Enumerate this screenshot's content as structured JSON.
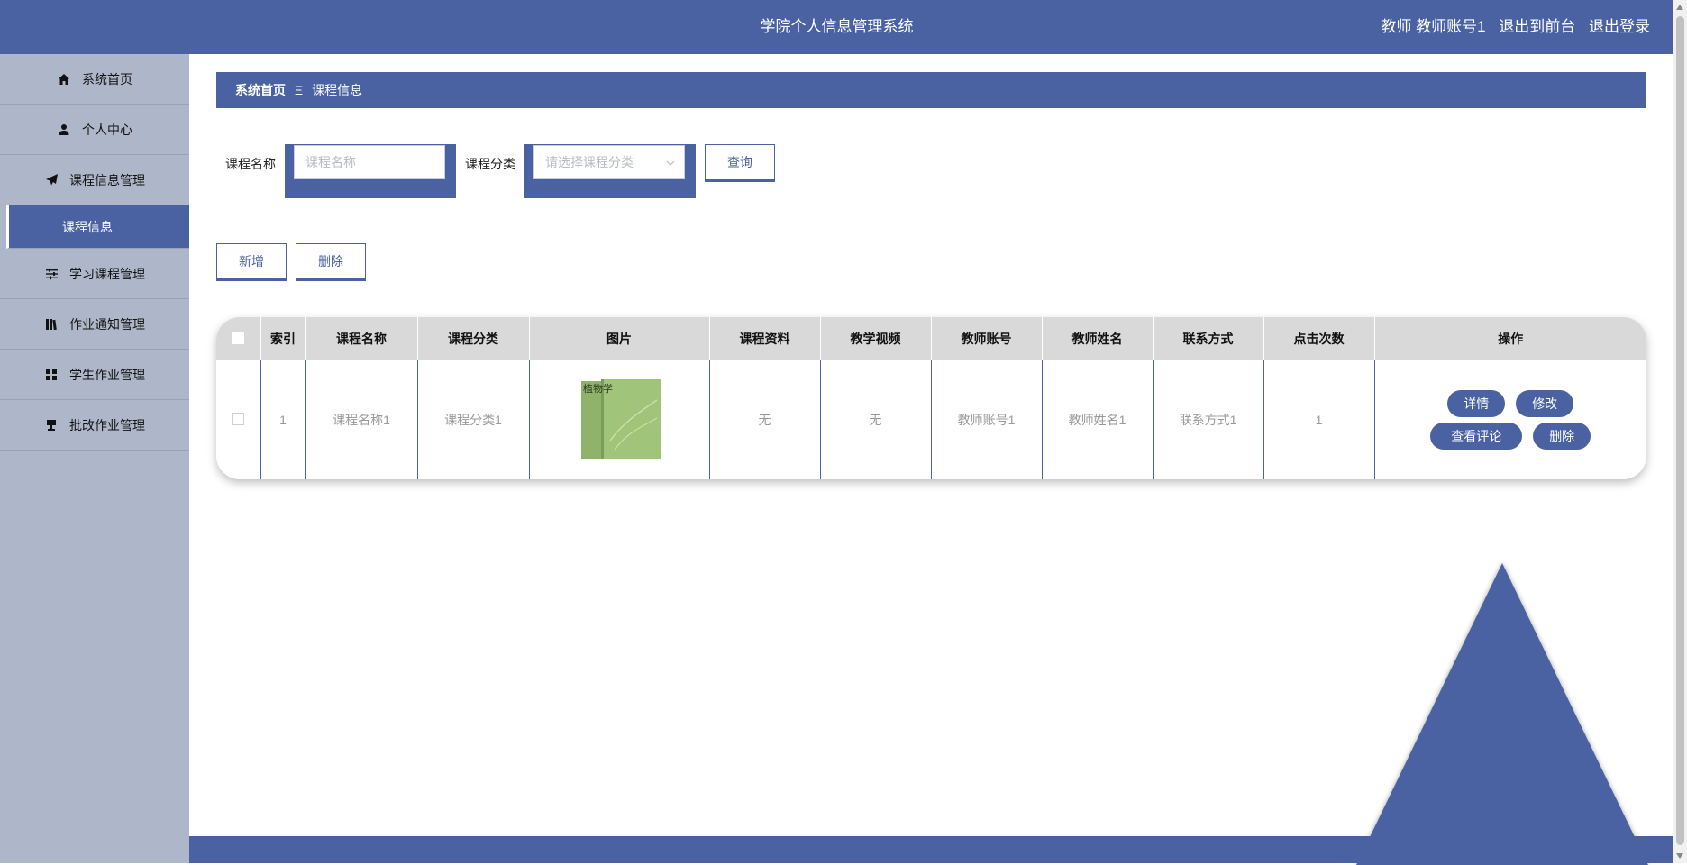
{
  "header": {
    "title": "学院个人信息管理系统",
    "user_role_label": "教师 教师账号1",
    "front_link": "退出到前台",
    "logout_link": "退出登录"
  },
  "sidebar": {
    "items": [
      {
        "label": "系统首页",
        "icon": "home-icon"
      },
      {
        "label": "个人中心",
        "icon": "user-icon"
      },
      {
        "label": "课程信息管理",
        "icon": "send-icon"
      },
      {
        "label": "课程信息",
        "icon": ""
      },
      {
        "label": "学习课程管理",
        "icon": "sliders-icon"
      },
      {
        "label": "作业通知管理",
        "icon": "book-icon"
      },
      {
        "label": "学生作业管理",
        "icon": "grid-icon"
      },
      {
        "label": "批改作业管理",
        "icon": "stamp-icon"
      }
    ]
  },
  "breadcrumb": {
    "home": "系统首页",
    "separator": "Ξ",
    "current": "课程信息"
  },
  "search": {
    "name_label": "课程名称",
    "name_placeholder": "课程名称",
    "category_label": "课程分类",
    "category_placeholder": "请选择课程分类",
    "query_button": "查询"
  },
  "actions": {
    "add_button": "新增",
    "delete_button": "删除"
  },
  "table": {
    "columns": [
      "索引",
      "课程名称",
      "课程分类",
      "图片",
      "课程资料",
      "教学视频",
      "教师账号",
      "教师姓名",
      "联系方式",
      "点击次数",
      "操作"
    ],
    "rows": [
      {
        "index": "1",
        "course_name": "课程名称1",
        "category": "课程分类1",
        "image_title": "植物学",
        "material": "无",
        "video": "无",
        "teacher_account": "教师账号1",
        "teacher_name": "教师姓名1",
        "contact": "联系方式1",
        "clicks": "1",
        "ops": {
          "detail": "详情",
          "edit": "修改",
          "comments": "查看评论",
          "delete": "删除"
        }
      }
    ]
  },
  "colors": {
    "primary": "#4a62a2",
    "sidebar_bg": "#aeb7ca",
    "table_header_bg": "#d9d9d9"
  }
}
